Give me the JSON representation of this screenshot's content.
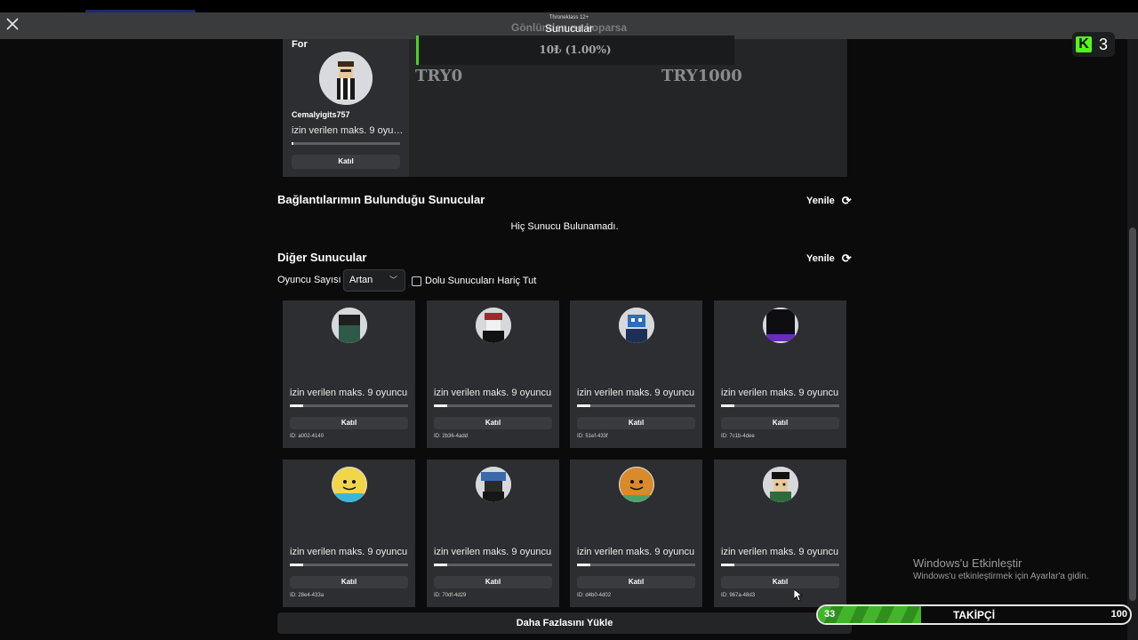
{
  "window": {
    "close_icon": "close-icon",
    "overlay_small": "Throneklass 12+",
    "overlay_title_ghost": "Gönlünden ne koparsa",
    "title": "Sunucular"
  },
  "kick": {
    "icon": "kick-logo-icon",
    "count": "3",
    "color": "#53fc18"
  },
  "featured": {
    "for_label": "For",
    "username": "Cemalyigits757",
    "description": "izin verilen maks. 9 oyuncu",
    "join_label": "Katıl"
  },
  "donation": {
    "progress_text": "10₺ (1.00%)",
    "min_label": "TRY0",
    "max_label": "TRY1000",
    "progress_percent": 1
  },
  "connections_section": {
    "title": "Bağlantılarımın Bulunduğu Sunucular",
    "refresh_label": "Yenile",
    "empty_text": "Hiç Sunucu Bulunamadı."
  },
  "other_section": {
    "title": "Diğer Sunucular",
    "refresh_label": "Yenile",
    "filter_label": "Oyuncu Sayısı",
    "sort_value": "Artan",
    "exclude_label": "Dolu Sunucuları Hariç Tut"
  },
  "servers": [
    {
      "description": "izin verilen maks. 9 oyuncu",
      "join_label": "Katıl",
      "id": "ID: a002-4140",
      "fill": 0.11
    },
    {
      "description": "izin verilen maks. 9 oyuncu",
      "join_label": "Katıl",
      "id": "ID: 2b36-4add",
      "fill": 0.11
    },
    {
      "description": "izin verilen maks. 9 oyuncu",
      "join_label": "Katıl",
      "id": "ID: 51ef-433f",
      "fill": 0.11
    },
    {
      "description": "izin verilen maks. 9 oyuncu",
      "join_label": "Katıl",
      "id": "ID: 7c1b-4dee",
      "fill": 0.11
    },
    {
      "description": "izin verilen maks. 9 oyuncu",
      "join_label": "Katıl",
      "id": "ID: 28e4-433a",
      "fill": 0.11
    },
    {
      "description": "izin verilen maks. 9 oyuncu",
      "join_label": "Katıl",
      "id": "ID: 70df-4d29",
      "fill": 0.11
    },
    {
      "description": "izin verilen maks. 9 oyuncu",
      "join_label": "Katıl",
      "id": "ID: d4b0-4d02",
      "fill": 0.11
    },
    {
      "description": "izin verilen maks. 9 oyuncu",
      "join_label": "Katıl",
      "id": "ID: 967a-48d3",
      "fill": 0.11
    }
  ],
  "load_more_label": "Daha Fazlasını Yükle",
  "windows_watermark": {
    "title": "Windows'u Etkinleştir",
    "subtitle": "Windows'u etkinleştirmek için Ayarlar'a gidin."
  },
  "follower_goal": {
    "current": "33",
    "label": "TAKİPÇİ",
    "target": "100",
    "fill_color": "#43b52a"
  }
}
